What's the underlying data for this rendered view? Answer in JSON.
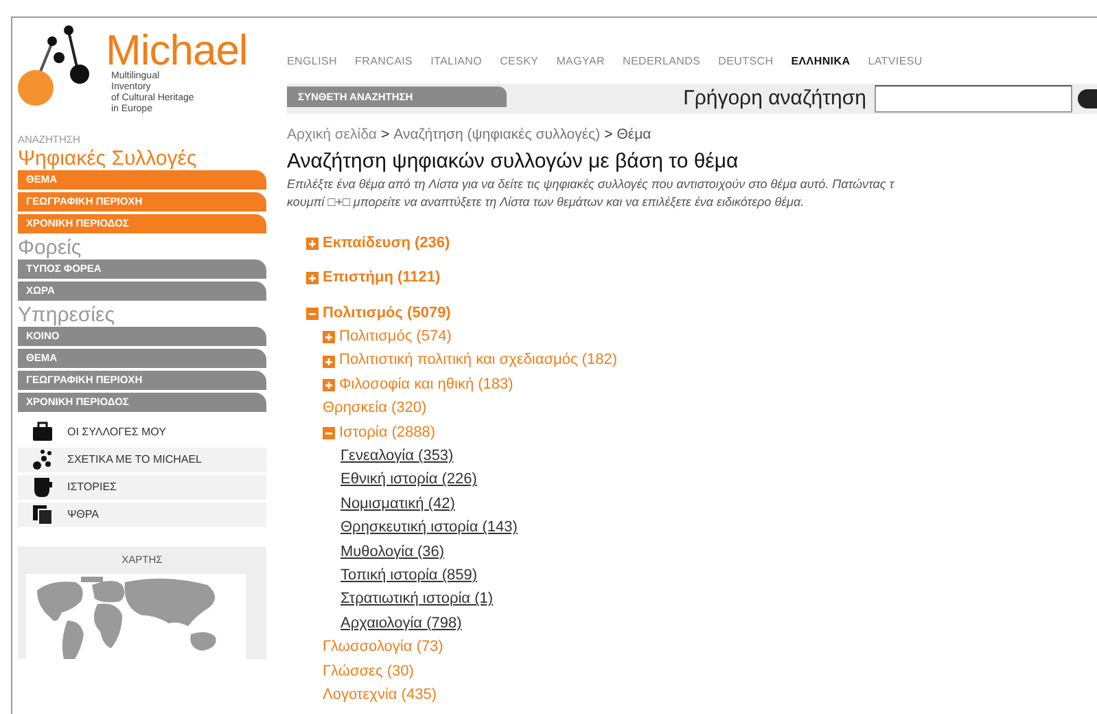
{
  "logo": {
    "name": "Michael",
    "tagline": [
      "Multilingual",
      "Inventory",
      "of Cultural Heritage",
      "in Europe"
    ]
  },
  "languages": [
    {
      "label": "ENGLISH",
      "selected": false
    },
    {
      "label": "FRANCAIS",
      "selected": false
    },
    {
      "label": "ITALIANO",
      "selected": false
    },
    {
      "label": "CESKY",
      "selected": false
    },
    {
      "label": "MAGYAR",
      "selected": false
    },
    {
      "label": "NEDERLANDS",
      "selected": false
    },
    {
      "label": "DEUTSCH",
      "selected": false
    },
    {
      "label": "ΕΛΛΗΝΙΚΑ",
      "selected": true
    },
    {
      "label": "LATVIESU",
      "selected": false
    }
  ],
  "advanced_search_tab": "ΣΥΝΘΕΤΗ ΑΝΑΖΗΤΗΣΗ",
  "quick_search": {
    "label": "Γρήγορη αναζήτηση"
  },
  "sidebar": {
    "caption": "ΑΝΑΖΗΤΗΣΗ",
    "sections": [
      {
        "title": "Ψηφιακές Συλλογές",
        "selected": true,
        "items": [
          "ΘΕΜΑ",
          "ΓΕΩΓΡΑΦΙΚΗ ΠΕΡΙΟΧΗ",
          "ΧΡΟΝΙΚΗ ΠΕΡΙΟΔΟΣ"
        ]
      },
      {
        "title": "Φορείς",
        "selected": false,
        "items": [
          "ΤΥΠΟΣ ΦΟΡΕΑ",
          "ΧΩΡΑ"
        ]
      },
      {
        "title": "Υπηρεσίες",
        "selected": false,
        "items": [
          "ΚΟΙΝΟ",
          "ΘΕΜΑ",
          "ΓΕΩΓΡΑΦΙΚΗ ΠΕΡΙΟΧΗ",
          "ΧΡΟΝΙΚΗ ΠΕΡΙΟΔΟΣ"
        ]
      }
    ],
    "links": [
      {
        "label": "ΟΙ ΣΥΛΛΟΓΕΣ ΜΟΥ",
        "kind": "briefcase"
      },
      {
        "label": "ΣΧΕΤΙΚΑ ΜΕ ΤΟ MICHAEL",
        "kind": "dots"
      },
      {
        "label": "ΙΣΤΟΡΙΕΣ",
        "kind": "cup"
      },
      {
        "label": "ΨΘΡΑ",
        "kind": "pages"
      }
    ],
    "map": {
      "title": "ΧΑΡΤΗΣ",
      "kind": "picture"
    }
  },
  "breadcrumb": [
    {
      "text": "Αρχική σελίδα",
      "kind": "link"
    },
    {
      "text": ">",
      "kind": "sep"
    },
    {
      "text": "Αναζήτηση (ψηφιακές συλλογές)",
      "kind": "link"
    },
    {
      "text": ">",
      "kind": "sep"
    },
    {
      "text": "Θέμα",
      "kind": "current"
    }
  ],
  "heading": "Αναζήτηση ψηφιακών συλλογών με βάση το θέμα",
  "intro": [
    "Επιλέξτε ένα θέμα από τη Λίστα για να δείτε τις ψηφιακές συλλογές που αντιστοιχούν στο θέμα αυτό. Πατώντας τ",
    "κουμπί □+□ μπορείτε να αναπτύξετε τη Λίστα των θεμάτων και να επιλέξετε ένα ειδικότερο θέμα."
  ],
  "topics": [
    {
      "label": "Εκπαίδευση (236)",
      "expanded": false
    },
    {
      "label": "Επιστήμη (1121)",
      "expanded": false
    },
    {
      "label": "Πολιτισμός (5079)",
      "expanded": true,
      "children": [
        {
          "label": "Πολιτισμός (574)",
          "expanded": false
        },
        {
          "label": "Πολιτιστική πολιτική και σχεδιασμός (182)",
          "expanded": false
        },
        {
          "label": "Φιλοσοφία και ηθική (183)",
          "expanded": false
        },
        {
          "label": "Θρησκεία (320)"
        },
        {
          "label": "Ιστορία (2888)",
          "expanded": true,
          "children": [
            {
              "label": "Γενεαλογία (353)"
            },
            {
              "label": "Εθνική ιστορία (226)"
            },
            {
              "label": "Νομισματική (42)"
            },
            {
              "label": "Θρησκευτική ιστορία (143)"
            },
            {
              "label": "Μυθολογία (36)"
            },
            {
              "label": "Τοπική ιστορία (859)"
            },
            {
              "label": "Στρατιωτική ιστορία (1)"
            },
            {
              "label": "Αρχαιολογία (798)"
            }
          ]
        },
        {
          "label": "Γλωσσολογία (73)"
        },
        {
          "label": "Γλώσσες (30)"
        },
        {
          "label": "Λογοτεχνία (435)"
        }
      ]
    }
  ]
}
